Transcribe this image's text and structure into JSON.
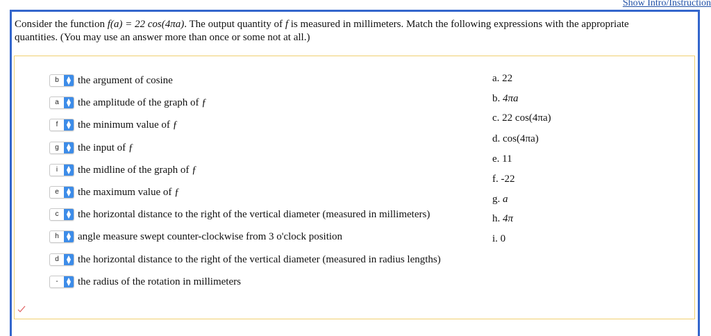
{
  "header": {
    "show_link": "Show Intro/Instruction"
  },
  "prompt": {
    "line1_a": "Consider the function",
    "func_lhs": "f(a) = 22 cos(4πa)",
    "line1_b": ". The output quantity of",
    "f": "f",
    "line1_c": "is measured in millimeters. Match the following expressions with the appropriate",
    "line2": "quantities. (You may use an answer more than once or some not at all.)"
  },
  "items": [
    {
      "selected": "b",
      "label": "the argument of cosine"
    },
    {
      "selected": "a",
      "label": "the amplitude of the graph of ƒ"
    },
    {
      "selected": "f",
      "label": "the minimum value of ƒ"
    },
    {
      "selected": "g",
      "label": "the input of ƒ"
    },
    {
      "selected": "i",
      "label": "the midline of the graph of ƒ"
    },
    {
      "selected": "e",
      "label": "the maximum value of ƒ"
    },
    {
      "selected": "c",
      "label": "the horizontal distance to the right of the vertical diameter (measured in millimeters)"
    },
    {
      "selected": "h",
      "label": "angle measure swept counter-clockwise from 3 o'clock position"
    },
    {
      "selected": "d",
      "label": "the horizontal distance to the right of the vertical diameter (measured in radius lengths)"
    },
    {
      "selected": "-",
      "label": "the radius of the rotation in millimeters"
    }
  ],
  "answers": [
    {
      "letter": "a.",
      "value": "22"
    },
    {
      "letter": "b.",
      "value": "4πa"
    },
    {
      "letter": "c.",
      "value": "22 cos(4πa)"
    },
    {
      "letter": "d.",
      "value": "cos(4πa)"
    },
    {
      "letter": "e.",
      "value": "11"
    },
    {
      "letter": "f.",
      "value": "-22"
    },
    {
      "letter": "g.",
      "value": "a"
    },
    {
      "letter": "h.",
      "value": "4π"
    },
    {
      "letter": "i.",
      "value": "0"
    }
  ],
  "colors": {
    "frame": "#3366cc",
    "box_border": "#f0d070",
    "select_arrow": "#3d8ce8",
    "link": "#1f4fa6"
  }
}
